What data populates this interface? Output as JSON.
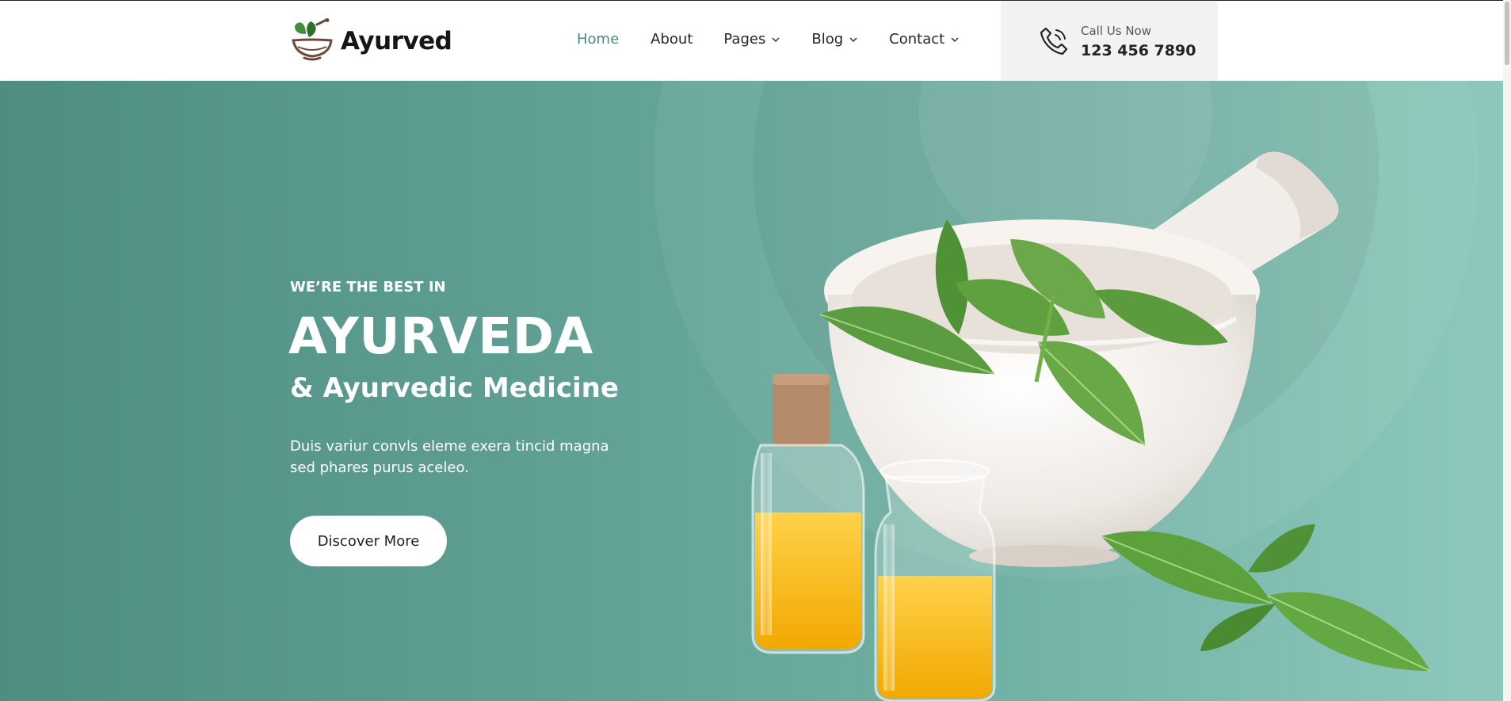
{
  "brand": {
    "name": "Ayurved",
    "logo_icon": "mortar-leaves-logo"
  },
  "nav": {
    "items": [
      {
        "label": "Home",
        "active": true,
        "dropdown": false
      },
      {
        "label": "About",
        "active": false,
        "dropdown": false
      },
      {
        "label": "Pages",
        "active": false,
        "dropdown": true
      },
      {
        "label": "Blog",
        "active": false,
        "dropdown": true
      },
      {
        "label": "Contact",
        "active": false,
        "dropdown": true
      }
    ]
  },
  "call": {
    "label": "Call Us Now",
    "number": "123 456 7890",
    "icon": "phone-icon"
  },
  "hero": {
    "eyebrow": "WE’RE THE BEST IN",
    "title": "AYURVEDA",
    "subtitle": "& Ayurvedic Medicine",
    "description": "Duis variur convls eleme exera tincid magna sed phares purus aceleo.",
    "cta_label": "Discover More"
  },
  "colors": {
    "accent": "#4d8b80",
    "hero_start": "#4f8d82",
    "hero_end": "#8ec8bc",
    "call_box": "#f2f2f2",
    "text_dark": "#1f1f1f"
  }
}
